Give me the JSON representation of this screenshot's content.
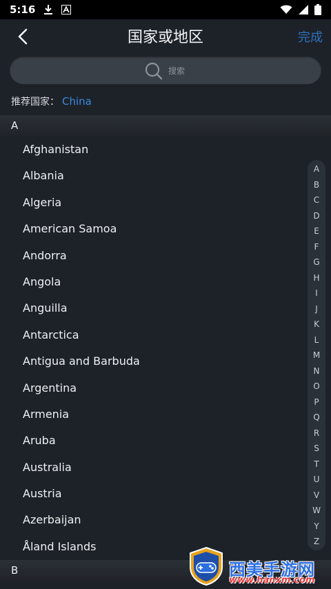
{
  "status_bar": {
    "time": "5:16"
  },
  "header": {
    "title": "国家或地区",
    "done_label": "完成"
  },
  "search": {
    "placeholder": "搜索"
  },
  "recommend": {
    "label": "推荐国家：",
    "country": "China"
  },
  "sections": {
    "a": "A",
    "b": "B"
  },
  "countries": [
    "Afghanistan",
    "Albania",
    "Algeria",
    "American Samoa",
    "Andorra",
    "Angola",
    "Anguilla",
    "Antarctica",
    "Antigua and Barbuda",
    "Argentina",
    "Armenia",
    "Aruba",
    "Australia",
    "Austria",
    "Azerbaijan",
    "Åland Islands"
  ],
  "alphabet": [
    "A",
    "B",
    "C",
    "D",
    "E",
    "F",
    "G",
    "H",
    "I",
    "J",
    "K",
    "L",
    "M",
    "N",
    "O",
    "P",
    "Q",
    "R",
    "S",
    "T",
    "U",
    "V",
    "W",
    "Y",
    "Z"
  ],
  "watermark": {
    "text": "西美手游网",
    "url": "www.hanxm.com"
  },
  "colors": {
    "background": "#1d2229",
    "accent": "#3b8be0",
    "done": "#2e6fba"
  }
}
